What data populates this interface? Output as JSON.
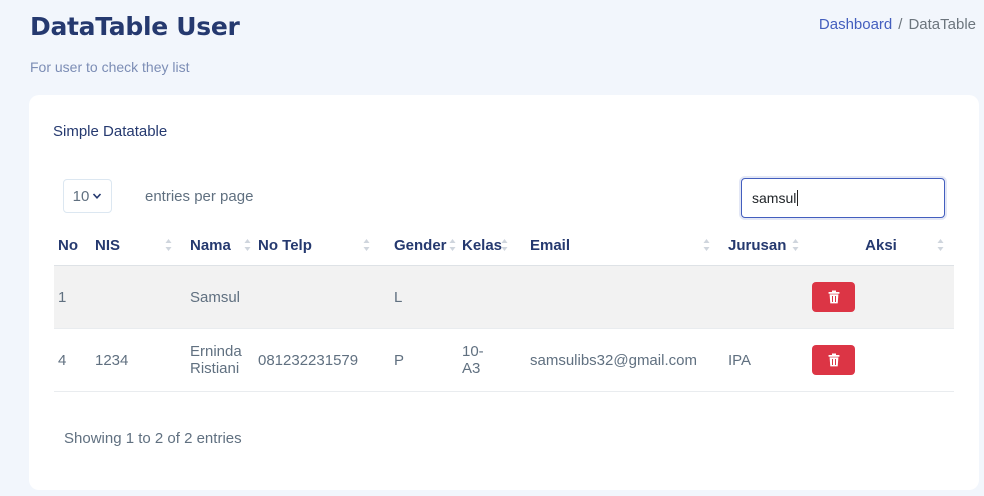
{
  "header": {
    "title": "DataTable User",
    "subtitle": "For user to check they list"
  },
  "breadcrumb": {
    "home": "Dashboard",
    "separator": "/",
    "current": "DataTable"
  },
  "card": {
    "title": "Simple Datatable",
    "per_page_value": "10",
    "per_page_label": "entries per page",
    "search_value": "samsul"
  },
  "table": {
    "columns": [
      "No",
      "NIS",
      "Nama",
      "No Telp",
      "Gender",
      "Kelas",
      "Email",
      "Jurusan",
      "Aksi"
    ],
    "rows": [
      {
        "no": "1",
        "nis": "",
        "nama_1": "Samsul",
        "nama_2": "",
        "telp": "",
        "gender": "L",
        "kelas_1": "",
        "kelas_2": "",
        "email": "",
        "jurusan": ""
      },
      {
        "no": "4",
        "nis": "1234",
        "nama_1": "Erninda",
        "nama_2": "Ristiani",
        "telp": "081232231579",
        "gender": "P",
        "kelas_1": "10-",
        "kelas_2": "A3",
        "email": "samsulibs32@gmail.com",
        "jurusan": "IPA"
      }
    ]
  },
  "footer": {
    "info": "Showing 1 to 2 of 2 entries"
  },
  "colors": {
    "primary": "#435ebe",
    "danger": "#dc3545",
    "heading": "#25396f",
    "background": "#f2f6fc"
  },
  "icons": {
    "delete": "trash-icon",
    "sort": "sort-arrows-icon",
    "dropdown": "chevron-down-icon"
  }
}
